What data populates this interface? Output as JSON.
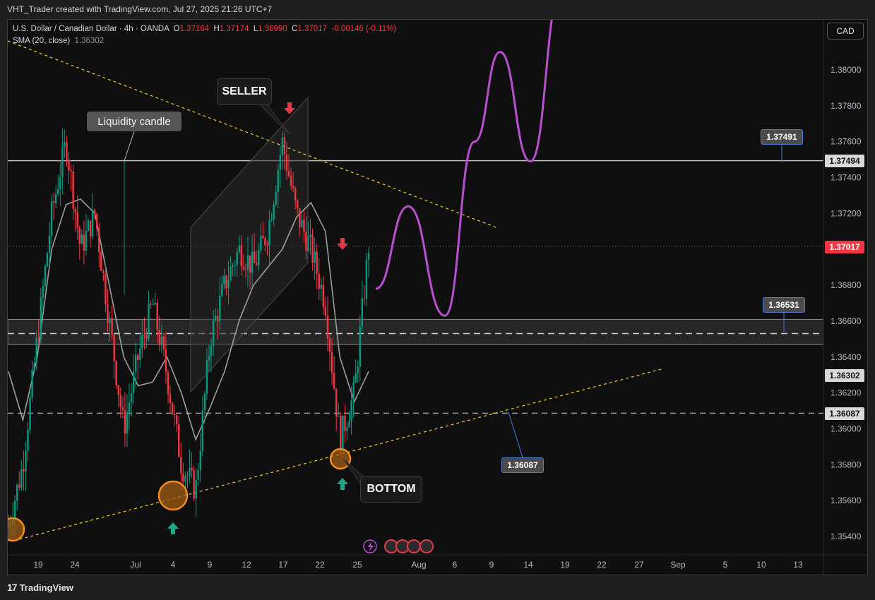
{
  "header": {
    "credit": "VHT_Trader created with TradingView.com, Jul 27, 2025 21:26 UTC+7"
  },
  "legend": {
    "symbol": "U.S. Dollar / Canadian Dollar · 4h · OANDA",
    "o_label": "O",
    "o_value": "1.37164",
    "h_label": "H",
    "h_value": "1.37174",
    "l_label": "L",
    "l_value": "1.36990",
    "c_label": "C",
    "c_value": "1.37017",
    "change": "-0.00146 (-0.11%)",
    "sma_label": "SMA (20, close)",
    "sma_value": "1.36302"
  },
  "currency_button": "CAD",
  "annotations": {
    "seller": "SELLER",
    "bottom": "BOTTOM",
    "liquidity": "Liquidity candle"
  },
  "price_tags": {
    "resistance": "1.37494",
    "last": "1.37017",
    "sma": "1.36302",
    "support": "1.36087"
  },
  "note_tags": {
    "upper": "1.37491",
    "middle": "1.36531",
    "lower": "1.36087"
  },
  "footer": {
    "brand": "TradingView"
  },
  "colors": {
    "up": "#089981",
    "down": "#f23645",
    "projection": "#b84fd1",
    "trendline": "#e6c229",
    "background": "#0f0f0f"
  },
  "chart_data": {
    "type": "candlestick",
    "symbol": "USDCAD",
    "interval": "4h",
    "ylim": [
      1.3535,
      1.3826
    ],
    "y_ticks": [
      "1.38000",
      "1.37800",
      "1.37600",
      "1.37400",
      "1.37200",
      "1.36800",
      "1.36600",
      "1.36400",
      "1.36200",
      "1.36000",
      "1.35800",
      "1.35600",
      "1.35400"
    ],
    "x_ticks": [
      "19",
      "24",
      "Jul",
      "4",
      "9",
      "12",
      "17",
      "22",
      "25",
      "Aug",
      "6",
      "9",
      "14",
      "19",
      "22",
      "27",
      "Sep",
      "5",
      "10",
      "13"
    ],
    "last_price": 1.37017,
    "horizontal_levels": [
      1.37494,
      1.36087
    ],
    "zone": [
      1.3647,
      1.3661
    ],
    "zone_mid": 1.36531,
    "sma20_approx": [
      1.3632,
      1.3605,
      1.364,
      1.37,
      1.3725,
      1.3728,
      1.372,
      1.368,
      1.364,
      1.3624,
      1.3626,
      1.364,
      1.362,
      1.3594,
      1.3612,
      1.3632,
      1.366,
      1.368,
      1.369,
      1.37,
      1.3718,
      1.3726,
      1.371,
      1.364,
      1.3615,
      1.3632
    ],
    "close_path_approx": [
      1.3546,
      1.358,
      1.365,
      1.372,
      1.376,
      1.37,
      1.372,
      1.366,
      1.36,
      1.364,
      1.367,
      1.363,
      1.358,
      1.3566,
      1.365,
      1.368,
      1.37,
      1.369,
      1.371,
      1.376,
      1.372,
      1.37,
      1.367,
      1.3594,
      1.362,
      1.3702
    ],
    "projection_path": [
      1.3678,
      1.3724,
      1.3663,
      1.376,
      1.381,
      1.3749,
      1.3845
    ]
  }
}
